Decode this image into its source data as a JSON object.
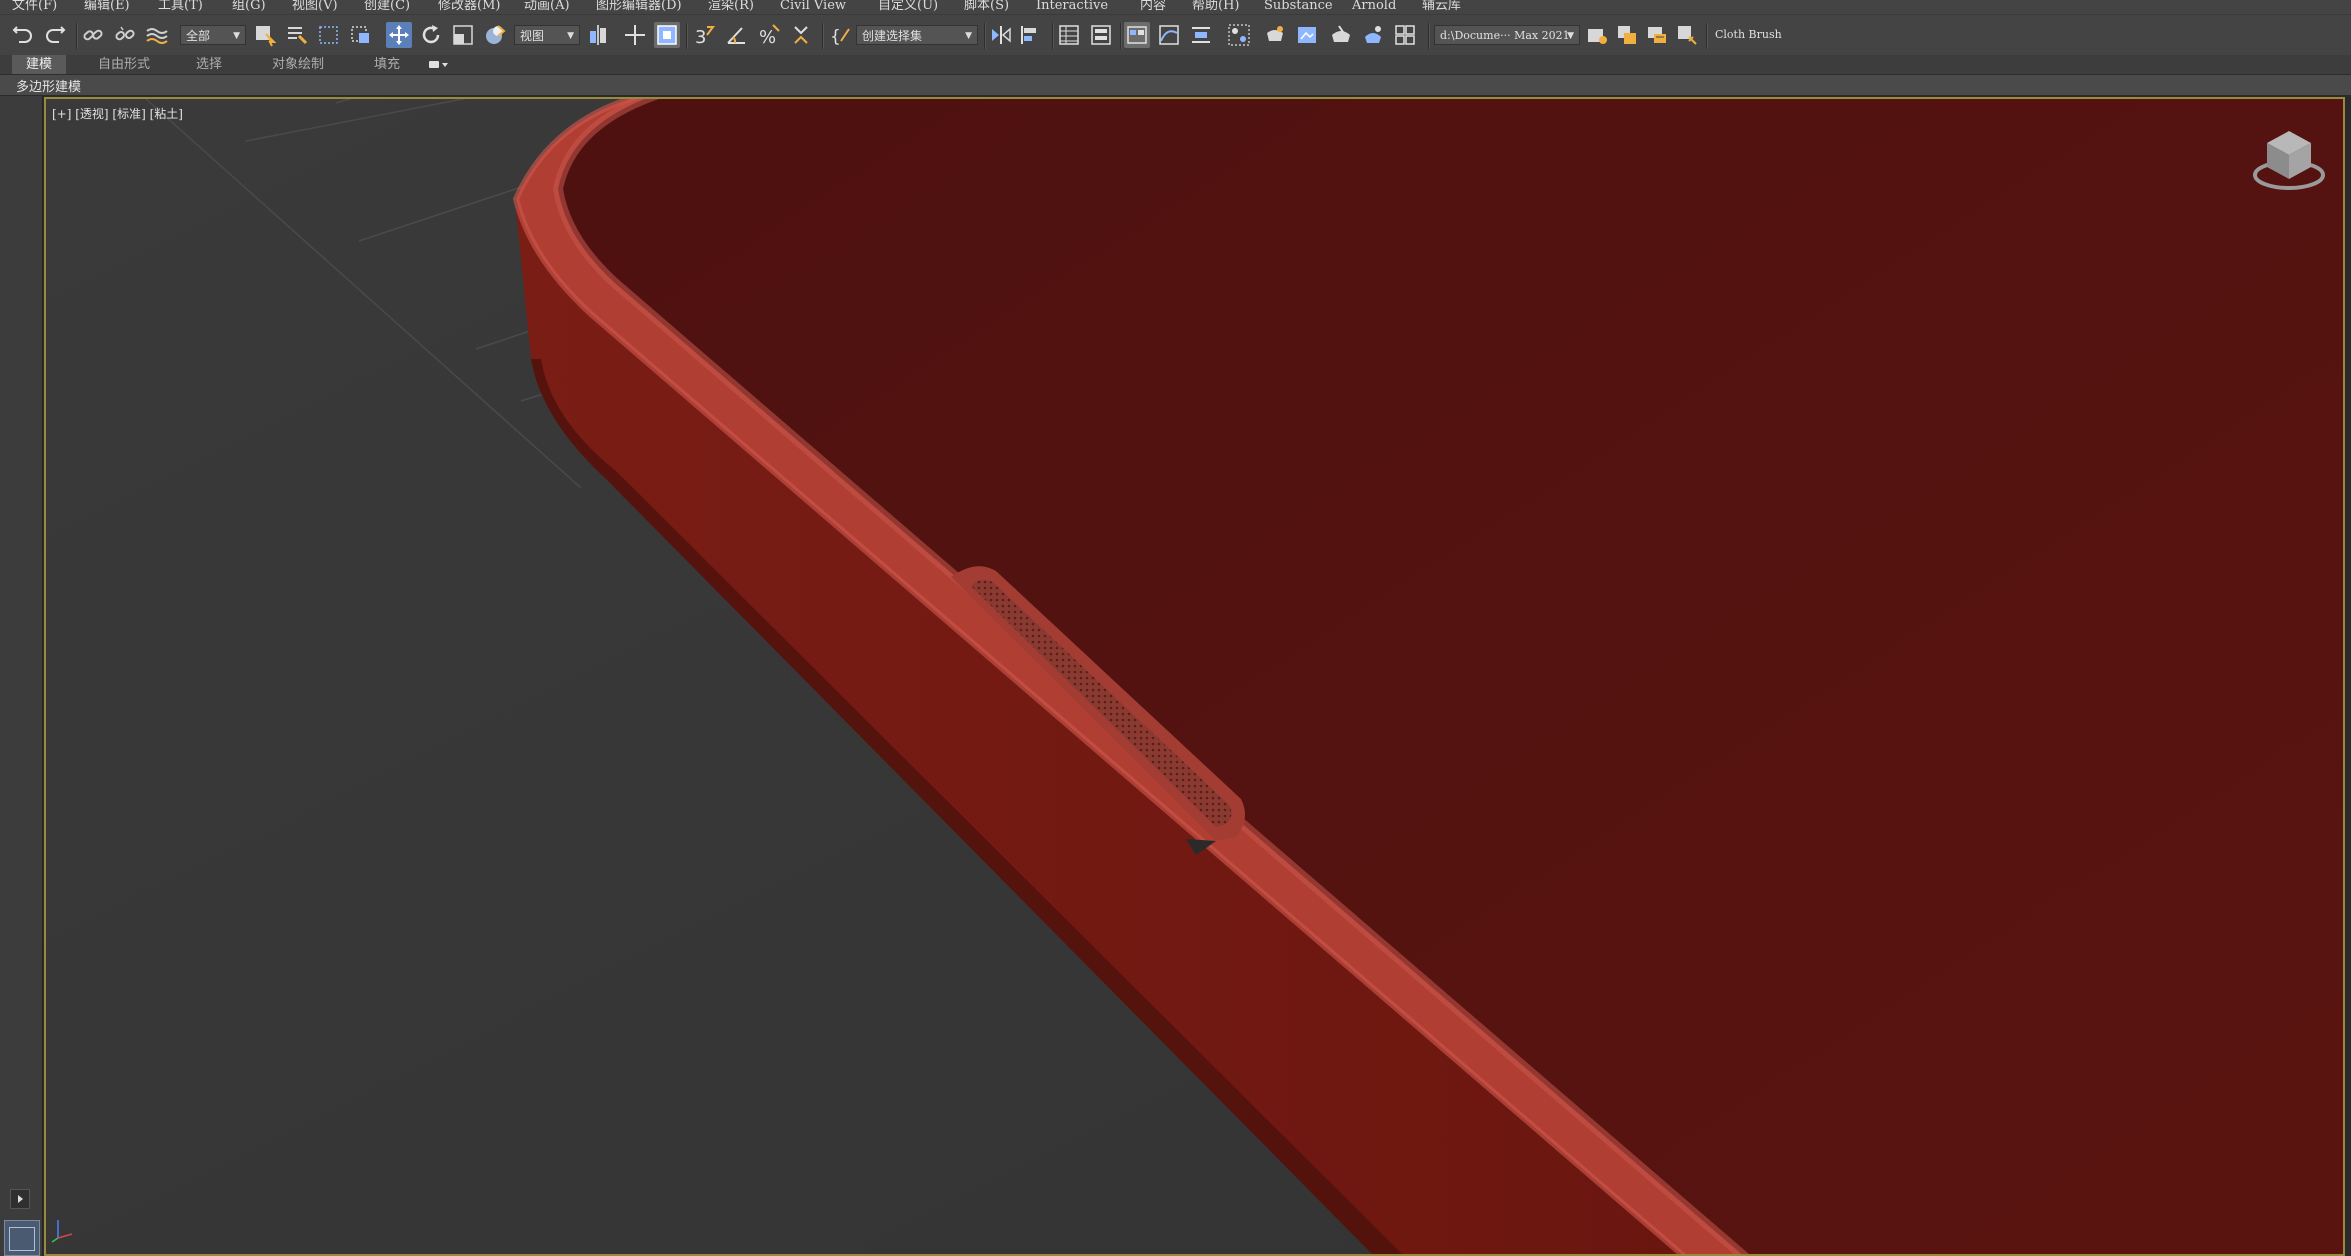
{
  "menu": [
    {
      "label": "文件(F)"
    },
    {
      "label": "编辑(E)"
    },
    {
      "label": "工具(T)"
    },
    {
      "label": "组(G)"
    },
    {
      "label": "视图(V)"
    },
    {
      "label": "创建(C)"
    },
    {
      "label": "修改器(M)"
    },
    {
      "label": "动画(A)"
    },
    {
      "label": "图形编辑器(D)"
    },
    {
      "label": "渲染(R)"
    },
    {
      "label": "Civil View"
    },
    {
      "label": "自定义(U)"
    },
    {
      "label": "脚本(S)"
    },
    {
      "label": "Interactive"
    },
    {
      "label": "内容"
    },
    {
      "label": "帮助(H)"
    },
    {
      "label": "Substance"
    },
    {
      "label": "Arnold"
    },
    {
      "label": "辅云库"
    }
  ],
  "toolbar": {
    "selection_filter": "全部",
    "reference_coord": "视图",
    "named_selection": "创建选择集",
    "project_path": "d:\\Docume··· Max 2021",
    "workspace_label": "Cloth Brush"
  },
  "ribbon": {
    "tabs": [
      {
        "label": "建模"
      },
      {
        "label": "自由形式"
      },
      {
        "label": "选择"
      },
      {
        "label": "对象绘制"
      },
      {
        "label": "填充"
      }
    ],
    "sub_panel": "多边形建模"
  },
  "viewport": {
    "label": "[+] [透视] [标准] [粘土]",
    "object_color": "#5a1410",
    "edge_color": "#c0473c"
  }
}
